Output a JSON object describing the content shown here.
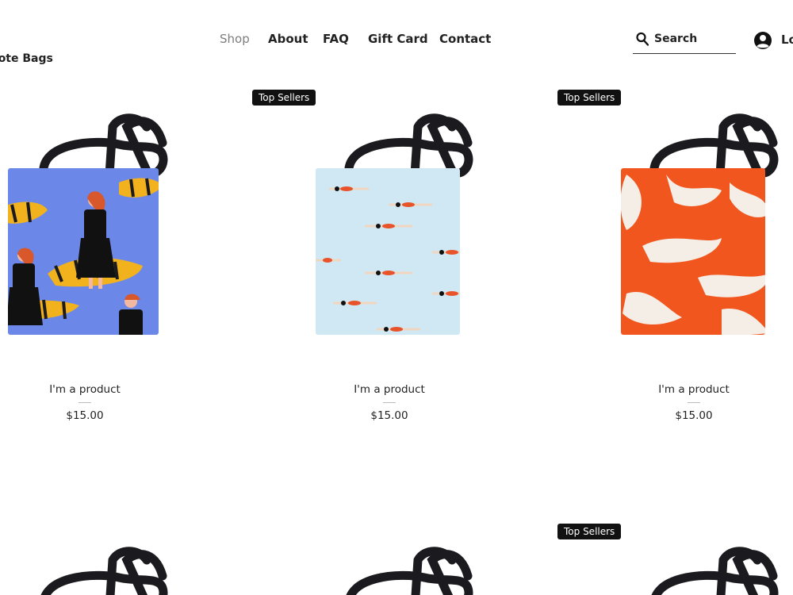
{
  "nav": {
    "items": [
      {
        "label": "Shop",
        "active": true
      },
      {
        "label": "About"
      },
      {
        "label": "FAQ"
      },
      {
        "label": "Gift Card"
      },
      {
        "label": "Contact"
      }
    ]
  },
  "search": {
    "placeholder": "Search",
    "icon": "search-icon"
  },
  "login": {
    "label": "Log In",
    "icon": "account-icon"
  },
  "page_title": "Tote Bags",
  "badge_label": "Top Sellers",
  "products": [
    {
      "name": "I'm a product",
      "price": "$15.00",
      "badge": false,
      "pattern": "tiger-girl",
      "color": "#6b88e8"
    },
    {
      "name": "I'm a product",
      "price": "$15.00",
      "badge": true,
      "pattern": "swimmers",
      "color": "#cfe8f3"
    },
    {
      "name": "I'm a product",
      "price": "$15.00",
      "badge": true,
      "pattern": "orange-brush",
      "color": "#f0561e"
    },
    {
      "name": "",
      "price": "",
      "badge": false,
      "pattern": "handle-only"
    },
    {
      "name": "",
      "price": "",
      "badge": false,
      "pattern": "handle-only"
    },
    {
      "name": "",
      "price": "",
      "badge": true,
      "pattern": "handle-only"
    }
  ],
  "colors": {
    "text": "#222222",
    "active_nav": "#7d7d7d",
    "badge_bg": "#111111",
    "handle": "#1b1b1f"
  }
}
